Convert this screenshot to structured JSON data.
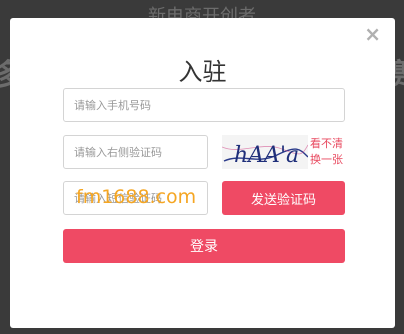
{
  "background": {
    "top_text": "新电商开创者",
    "left_text": "多",
    "right_text": "赛"
  },
  "modal": {
    "close_glyph": "×",
    "title": "入驻",
    "phone_placeholder": "请输入手机号码",
    "captcha_placeholder": "请输入右侧验证码",
    "captcha_text": "hAA'a",
    "refresh_line1": "看不清",
    "refresh_line2": "换一张",
    "sms_placeholder": "请输入短信验证码",
    "sms_button": "发送验证码",
    "login_button": "登录",
    "watermark": "fm1688.com"
  },
  "colors": {
    "accent": "#ef4a64",
    "watermark": "#f5a623"
  }
}
